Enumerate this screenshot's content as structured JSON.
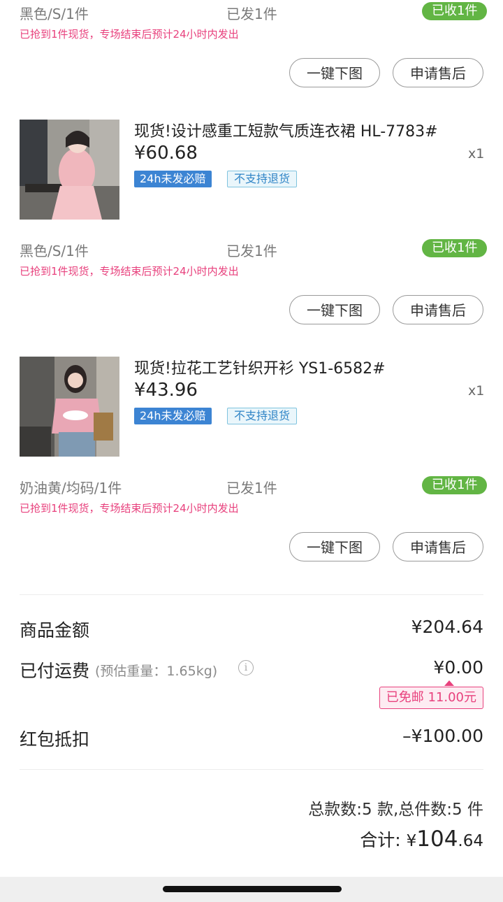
{
  "top_item": {
    "spec": "黑色/S/1件",
    "shipped": "已发1件",
    "received": "已收1件",
    "note": "已抢到1件现货，专场结束后预计24小时内发出",
    "btn_download": "一键下图",
    "btn_aftersale": "申请售后"
  },
  "items": [
    {
      "title": "现货!设计感重工短款气质连衣裙 HL-7783#",
      "price": "¥60.68",
      "qty": "x1",
      "tag1": "24h未发必赔",
      "tag2": "不支持退货",
      "spec": "黑色/S/1件",
      "shipped": "已发1件",
      "received": "已收1件",
      "note": "已抢到1件现货，专场结束后预计24小时内发出",
      "btn_download": "一键下图",
      "btn_aftersale": "申请售后"
    },
    {
      "title": "现货!拉花工艺针织开衫 YS1-6582#",
      "price": "¥43.96",
      "qty": "x1",
      "tag1": "24h未发必赔",
      "tag2": "不支持退货",
      "spec": "奶油黄/均码/1件",
      "shipped": "已发1件",
      "received": "已收1件",
      "note": "已抢到1件现货，专场结束后预计24小时内发出",
      "btn_download": "一键下图",
      "btn_aftersale": "申请售后"
    }
  ],
  "summary": {
    "goods_label": "商品金额",
    "goods_value": "¥204.64",
    "shipping_label": "已付运费",
    "shipping_hint": "(预估重量：1.65kg)",
    "shipping_value": "¥0.00",
    "free_shipping": "已免邮 11.00元",
    "redpacket_label": "红包抵扣",
    "redpacket_value": "–¥100.00",
    "counts": "总款数:5 款,总件数:5 件",
    "total_label": "合计: ",
    "total_currency": "¥",
    "total_int": "104",
    "total_dec": ".64"
  },
  "colors": {
    "received_green": "#62b544",
    "note_pink": "#e8417d",
    "tag_blue": "#3c84d3"
  }
}
